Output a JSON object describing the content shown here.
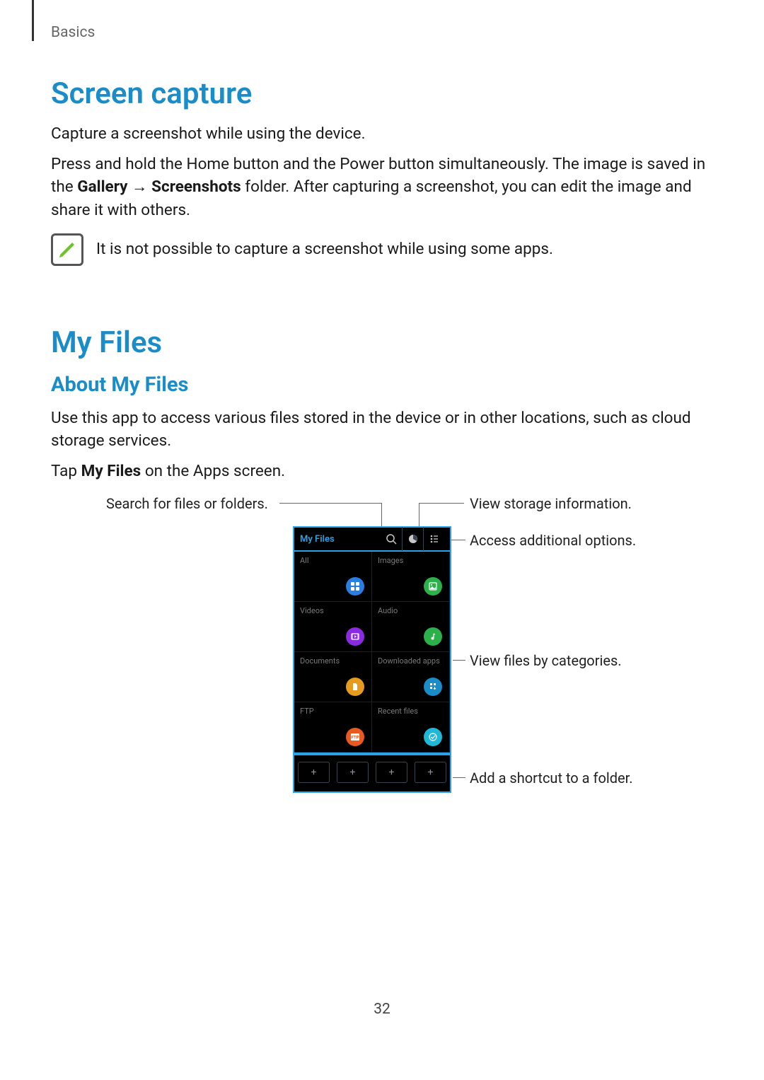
{
  "breadcrumb": "Basics",
  "page_number": "32",
  "screen_capture": {
    "heading": "Screen capture",
    "intro": "Capture a screenshot while using the device.",
    "body_pre": "Press and hold the Home button and the Power button simultaneously. The image is saved in the ",
    "bold1": "Gallery",
    "arrow": " → ",
    "bold2": "Screenshots",
    "body_post": " folder. After capturing a screenshot, you can edit the image and share it with others.",
    "note": "It is not possible to capture a screenshot while using some apps."
  },
  "my_files": {
    "heading": "My Files",
    "sub": "About My Files",
    "p1": "Use this app to access various files stored in the device or in other locations, such as cloud storage services.",
    "p2_pre": "Tap ",
    "p2_bold": "My Files",
    "p2_post": " on the Apps screen."
  },
  "phone": {
    "title": "My Files",
    "categories": [
      {
        "label": "All",
        "color": "#2a7de1"
      },
      {
        "label": "Images",
        "color": "#2bb04a"
      },
      {
        "label": "Videos",
        "color": "#8a2be2"
      },
      {
        "label": "Audio",
        "color": "#2bb04a"
      },
      {
        "label": "Documents",
        "color": "#e69b1e"
      },
      {
        "label": "Downloaded apps",
        "color": "#1a8cc7"
      },
      {
        "label": "FTP",
        "color": "#e85a1f"
      },
      {
        "label": "Recent files",
        "color": "#1fb8d6"
      }
    ]
  },
  "callouts": {
    "search": "Search for files or folders.",
    "storage": "View storage information.",
    "options": "Access additional options.",
    "categories": "View files by categories.",
    "shortcut": "Add a shortcut to a folder."
  }
}
